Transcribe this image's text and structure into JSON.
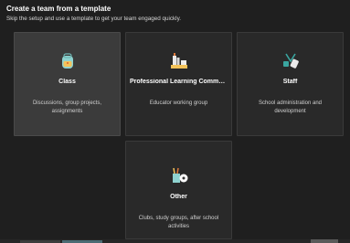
{
  "header": {
    "title": "Create a team from a template",
    "subtitle": "Skip the setup and use a template to get your team engaged quickly."
  },
  "templates": [
    {
      "title": "Class",
      "description": "Discussions, group projects, assignments",
      "icon": "backpack-icon"
    },
    {
      "title": "Professional Learning Communi...",
      "description": "Educator working group",
      "icon": "books-pencil-icon"
    },
    {
      "title": "Staff",
      "description": "School administration and development",
      "icon": "lanyard-badge-icon"
    },
    {
      "title": "Other",
      "description": "Clubs, study groups, after school activities",
      "icon": "pencil-cup-ball-icon"
    }
  ],
  "colors": {
    "background": "#1f1f1f",
    "card": "#292929",
    "card_hover": "#3b3b3b",
    "accent_teal": "#3aa6a0"
  }
}
